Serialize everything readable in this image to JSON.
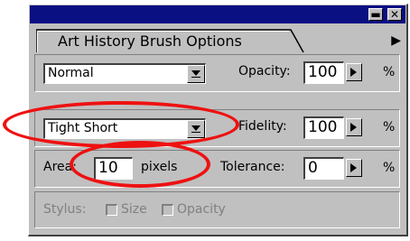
{
  "panel": {
    "tab_label": "Art History Brush Options",
    "titlebar_minimize": "▬",
    "titlebar_close": "✕",
    "menu_arrow": "▶"
  },
  "row1": {
    "mode_value": "Normal",
    "opacity_label": "Opacity:",
    "opacity_value": "100",
    "opacity_unit": "%"
  },
  "row2": {
    "style_value": "Tight Short",
    "fidelity_label": "Fidelity:",
    "fidelity_value": "100",
    "fidelity_unit": "%"
  },
  "row3": {
    "area_label": "Area:",
    "area_value": "10",
    "area_unit": "pixels",
    "tolerance_label": "Tolerance:",
    "tolerance_value": "0",
    "tolerance_unit": "%"
  },
  "row4": {
    "stylus_label": "Stylus:",
    "size_label": "Size",
    "opacity_label": "Opacity"
  },
  "colors": {
    "titlebar": "#0a0f82",
    "panel": "#c0c0c0",
    "highlight": "#e11111"
  }
}
